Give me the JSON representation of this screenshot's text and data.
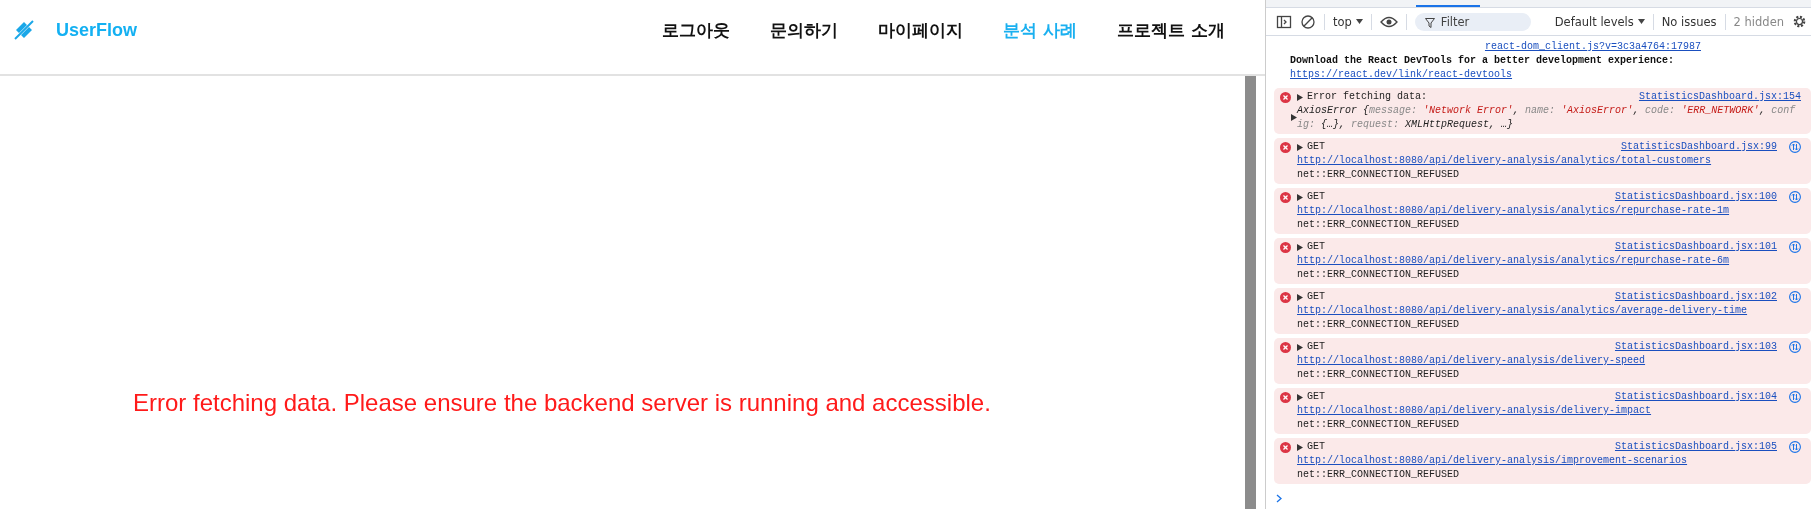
{
  "app": {
    "logo": {
      "name": "UserFlow"
    },
    "nav": [
      {
        "label": "로그아웃",
        "selected": false
      },
      {
        "label": "문의하기",
        "selected": false
      },
      {
        "label": "마이페이지",
        "selected": false
      },
      {
        "label": "분석 사례",
        "selected": true
      },
      {
        "label": "프로젝트 소개",
        "selected": false
      }
    ],
    "error_message": "Error fetching data. Please ensure the backend server is running and accessible."
  },
  "devtools": {
    "toolbar": {
      "context": "top",
      "filter": {
        "placeholder": "Filter"
      },
      "levels": "Default levels",
      "issues": "No issues",
      "hidden": "2 hidden"
    },
    "messages": [
      {
        "kind": "info",
        "source": "react-dom_client.js?v=3c3a4764:17987",
        "text": "Download the React DevTools for a better development experience:",
        "link": "https://react.dev/link/react-devtools"
      },
      {
        "kind": "object",
        "source": "StatisticsDashboard.jsx:154",
        "text": "Error fetching data:",
        "preview": [
          {
            "text": "AxiosError {",
            "kind": "plain"
          },
          {
            "text": "message: ",
            "kind": "key"
          },
          {
            "text": "'Network Error'",
            "kind": "string"
          },
          {
            "text": ", ",
            "kind": "plain"
          },
          {
            "text": "name: ",
            "kind": "key"
          },
          {
            "text": "'AxiosError'",
            "kind": "string"
          },
          {
            "text": ", ",
            "kind": "plain"
          },
          {
            "text": "code: ",
            "kind": "key"
          },
          {
            "text": "'ERR_NETWORK'",
            "kind": "string"
          },
          {
            "text": ", ",
            "kind": "plain"
          },
          {
            "text": "config: ",
            "kind": "key"
          },
          {
            "text": "{…}",
            "kind": "plain"
          },
          {
            "text": ", ",
            "kind": "plain"
          },
          {
            "text": "request: ",
            "kind": "key"
          },
          {
            "text": "XMLHttpRequest",
            "kind": "plain"
          },
          {
            "text": ", …}",
            "kind": "plain"
          }
        ]
      },
      {
        "kind": "network",
        "method": "GET",
        "source": "StatisticsDashboard.jsx:99",
        "url": "http://localhost:8080/api/delivery-analysis/analytics/total-customers",
        "error": "net::ERR_CONNECTION_REFUSED"
      },
      {
        "kind": "network",
        "method": "GET",
        "source": "StatisticsDashboard.jsx:100",
        "url": "http://localhost:8080/api/delivery-analysis/analytics/repurchase-rate-1m",
        "error": "net::ERR_CONNECTION_REFUSED"
      },
      {
        "kind": "network",
        "method": "GET",
        "source": "StatisticsDashboard.jsx:101",
        "url": "http://localhost:8080/api/delivery-analysis/analytics/repurchase-rate-6m",
        "error": "net::ERR_CONNECTION_REFUSED"
      },
      {
        "kind": "network",
        "method": "GET",
        "source": "StatisticsDashboard.jsx:102",
        "url": "http://localhost:8080/api/delivery-analysis/analytics/average-delivery-time",
        "error": "net::ERR_CONNECTION_REFUSED"
      },
      {
        "kind": "network",
        "method": "GET",
        "source": "StatisticsDashboard.jsx:103",
        "url": "http://localhost:8080/api/delivery-analysis/delivery-speed",
        "error": "net::ERR_CONNECTION_REFUSED"
      },
      {
        "kind": "network",
        "method": "GET",
        "source": "StatisticsDashboard.jsx:104",
        "url": "http://localhost:8080/api/delivery-analysis/delivery-impact",
        "error": "net::ERR_CONNECTION_REFUSED"
      },
      {
        "kind": "network",
        "method": "GET",
        "source": "StatisticsDashboard.jsx:105",
        "url": "http://localhost:8080/api/delivery-analysis/improvement-scenarios",
        "error": "net::ERR_CONNECTION_REFUSED"
      }
    ]
  }
}
